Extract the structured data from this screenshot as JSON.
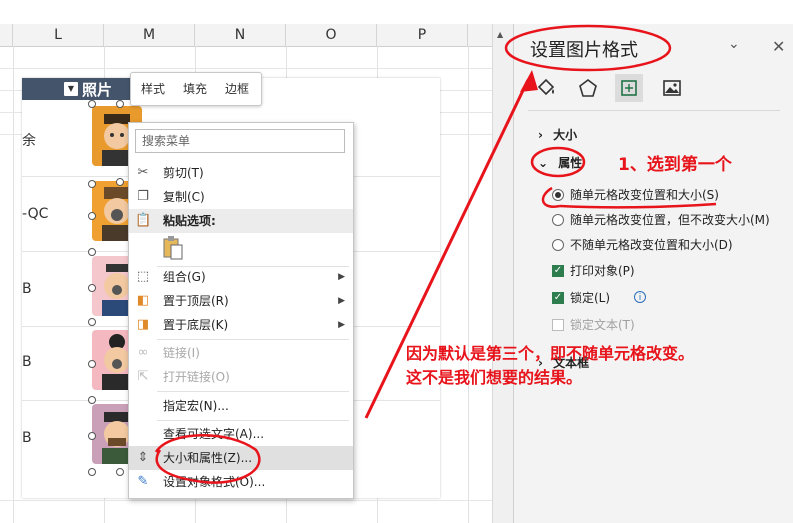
{
  "sheet": {
    "columns": [
      "L",
      "M",
      "N",
      "O",
      "P"
    ],
    "table_header": "照片",
    "row_labels": [
      "余",
      "-QC",
      "B",
      "B",
      "B"
    ]
  },
  "minibar": {
    "style_label": "样式",
    "fill_label": "填充",
    "border_label": "边框"
  },
  "context_menu": {
    "search_placeholder": "搜索菜单",
    "items": [
      {
        "label": "剪切(T)",
        "icon": "scissors-icon"
      },
      {
        "label": "复制(C)",
        "icon": "copy-icon"
      },
      {
        "label": "粘贴选项:",
        "icon": "paste-icon"
      },
      {
        "label": "组合(G)",
        "icon": "group-icon"
      },
      {
        "label": "置于顶层(R)",
        "icon": "bring-front-icon"
      },
      {
        "label": "置于底层(K)",
        "icon": "send-back-icon"
      },
      {
        "label": "链接(I)",
        "icon": "link-icon"
      },
      {
        "label": "打开链接(O)",
        "icon": "open-link-icon"
      },
      {
        "label": "指定宏(N)...",
        "icon": ""
      },
      {
        "label": "查看可选文字(A)...",
        "icon": ""
      },
      {
        "label": "大小和属性(Z)...",
        "icon": "size-props-icon"
      },
      {
        "label": "设置对象格式(O)...",
        "icon": "format-icon"
      }
    ]
  },
  "pane": {
    "title": "设置图片格式",
    "section_size": "大小",
    "section_props": "属性",
    "options": [
      {
        "label": "随单元格改变位置和大小(S)",
        "type": "radio",
        "checked": true
      },
      {
        "label": "随单元格改变位置，但不改变大小(M)",
        "type": "radio",
        "checked": false
      },
      {
        "label": "不随单元格改变位置和大小(D)",
        "type": "radio",
        "checked": false
      },
      {
        "label": "打印对象(P)",
        "type": "checkbox",
        "checked": true
      },
      {
        "label": "锁定(L)",
        "type": "checkbox",
        "checked": true
      },
      {
        "label": "锁定文本(T)",
        "type": "checkbox",
        "checked": false
      }
    ],
    "section_textbox": "文本框"
  },
  "annotations": {
    "step1": "1、选到第一个",
    "note_line1": "因为默认是第三个，即不随单元格改变。",
    "note_line2": "这不是我们想要的结果。"
  },
  "colors": {
    "annotation": "#e8141b",
    "table_header_bg": "#44546a",
    "checkbox": "#2e7d4f"
  }
}
